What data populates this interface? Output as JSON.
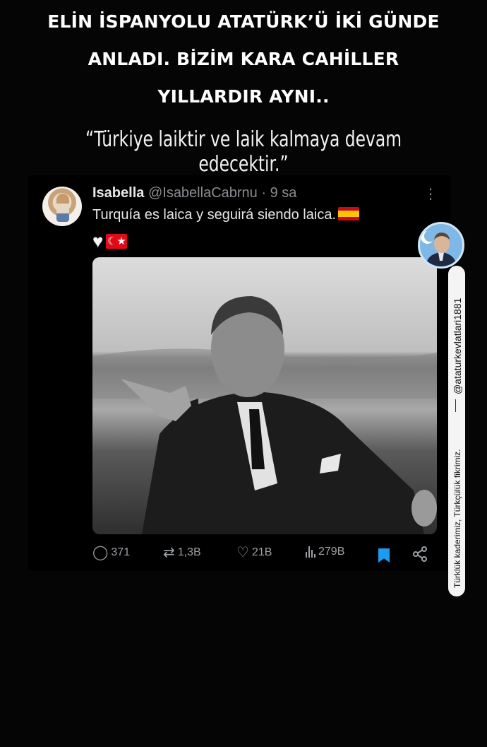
{
  "headline": {
    "line1": "ELİN İSPANYOLU ATATÜRK’Ü İKİ GÜNDE",
    "line2": "ANLADI. BİZİM KARA CAHİLLER",
    "line3": "YILLARDIR AYNI.."
  },
  "quote": "“Türkiye laiktir ve laik kalmaya devam edecektir.”",
  "tweet": {
    "author_name": "Isabella",
    "author_handle": "@IsabellaCabrnu",
    "time": "· 9 sa",
    "text": "Turquía es laica y seguirá siendo laica.",
    "replies": "371",
    "retweets": "1,3B",
    "likes": "21B",
    "views": "279B"
  },
  "watermark": {
    "handle": "@ataturkevlatlari1881",
    "slogan": "Türklük kaderimiz, Türkçülük fikrimiz."
  },
  "colors": {
    "background": "#050505",
    "bookmark": "#1d9bf0",
    "spain_red": "#c60b1e",
    "spain_yellow": "#ffc400",
    "turkey_red": "#e30a17"
  },
  "icons": [
    "more-icon",
    "white-heart-emoji",
    "spain-flag-emoji",
    "turkey-flag-emoji",
    "reply-icon",
    "retweet-icon",
    "like-icon",
    "views-icon",
    "bookmark-icon",
    "share-icon"
  ]
}
